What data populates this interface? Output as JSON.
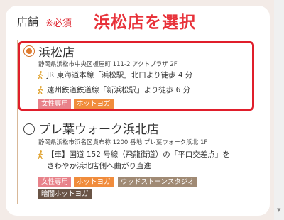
{
  "form": {
    "label": "店舗",
    "required": "※必須",
    "annotation": "浜松店を選択"
  },
  "stores": [
    {
      "name": "浜松店",
      "selected": true,
      "address": "静岡県浜松市中央区板屋町 111-2 アクトプラザ 2F",
      "access": [
        "JR 東海道本線「浜松駅」北口より徒歩 4 分",
        "遠州鉄道鉄道線「新浜松駅」より徒歩 6 分"
      ],
      "tags": [
        "女性専用",
        "ホットヨガ"
      ]
    },
    {
      "name": "プレ葉ウォーク浜北店",
      "selected": false,
      "address": "静岡県浜松市浜名区貴布祢 1200 番地 プレ葉ウォーク浜北 1F",
      "access_car_line1": "【車】国道 152 号線（飛龍街道）の「平口交差点」を",
      "access_car_line2": "さわやか浜北店側へ曲がり直進",
      "tags": [
        "女性専用",
        "ホットヨガ",
        "ウッドストーンスタジオ",
        "暗闇ホットヨガ"
      ]
    }
  ],
  "colors": {
    "accent": "#e07b2e",
    "highlight": "#e01e2b",
    "required": "#e0303a"
  },
  "icons": {
    "walk": "person-walking-icon",
    "car": "car-icon"
  }
}
